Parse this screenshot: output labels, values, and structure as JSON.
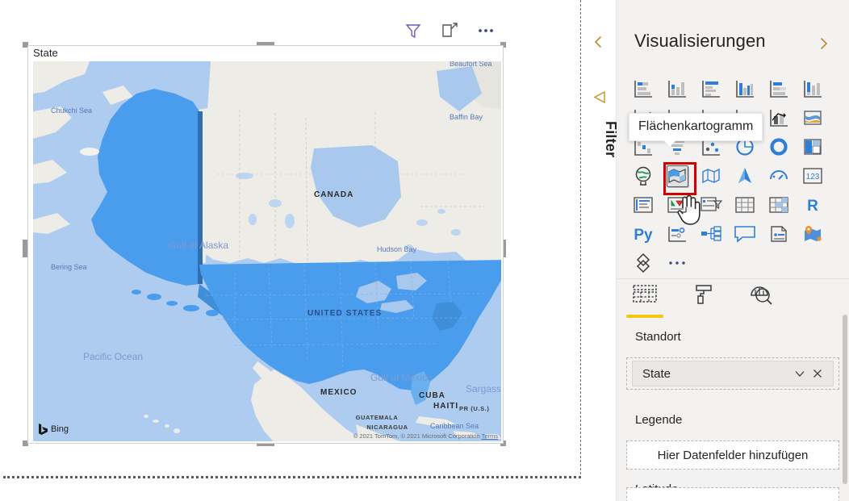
{
  "visual": {
    "title": "State",
    "toolbar": [
      {
        "name": "filter-icon",
        "label": "Filter"
      },
      {
        "name": "focus-mode-icon",
        "label": "Fokusmodus"
      },
      {
        "name": "more-options-icon",
        "label": "Weitere Optionen"
      }
    ],
    "map": {
      "provider": "Bing",
      "attribution": "© 2021 TomTom, © 2021 Microsoft Corporation",
      "terms_label": "Terms",
      "highlight_color": "#4a9ded",
      "water_color": "#aecbf0",
      "land_color": "#eeece7",
      "labels": [
        {
          "text": "Beaufort Sea",
          "type": "sea"
        },
        {
          "text": "Chukchi Sea",
          "type": "sea"
        },
        {
          "text": "Bering Sea",
          "type": "sea"
        },
        {
          "text": "Gulf of Alaska",
          "type": "sea-big"
        },
        {
          "text": "Hudson Bay",
          "type": "sea"
        },
        {
          "text": "Baffin Bay",
          "type": "sea"
        },
        {
          "text": "Pacific Ocean",
          "type": "sea-big"
        },
        {
          "text": "Gulf of Mexico",
          "type": "sea-big"
        },
        {
          "text": "Caribbean Sea",
          "type": "sea"
        },
        {
          "text": "Sargass",
          "type": "sea-big"
        },
        {
          "text": "CANADA",
          "type": "country"
        },
        {
          "text": "UNITED STATES",
          "type": "country-blue"
        },
        {
          "text": "MEXICO",
          "type": "country"
        },
        {
          "text": "CUBA",
          "type": "country"
        },
        {
          "text": "HAITI",
          "type": "country"
        },
        {
          "text": "PR (U.S.)",
          "type": "country-sm"
        },
        {
          "text": "GUATEMALA",
          "type": "country-sm"
        },
        {
          "text": "NICARAGUA",
          "type": "country-sm"
        }
      ]
    }
  },
  "filter_rail": {
    "collapse_label": "Filter-Bereich erweitern",
    "title": "Filter",
    "icons": [
      "chevron-left-icon",
      "filter-icon"
    ]
  },
  "viz_pane": {
    "title": "Visualisierungen",
    "expand_icon": "chevron-right-icon",
    "tooltip": "Flächenkartogramm",
    "icons": [
      {
        "name": "stacked-bar-chart",
        "row": 1
      },
      {
        "name": "stacked-column-chart",
        "row": 1
      },
      {
        "name": "clustered-bar-chart",
        "row": 1
      },
      {
        "name": "clustered-column-chart",
        "row": 1
      },
      {
        "name": "100-stacked-bar-chart",
        "row": 1
      },
      {
        "name": "100-stacked-column-chart",
        "row": 1
      },
      {
        "name": "line-chart",
        "row": 2
      },
      {
        "name": "area-chart",
        "row": 2
      },
      {
        "name": "stacked-area-chart",
        "row": 2
      },
      {
        "name": "line-stacked-column-chart",
        "row": 2
      },
      {
        "name": "line-clustered-column-chart",
        "row": 2
      },
      {
        "name": "ribbon-chart",
        "row": 2
      },
      {
        "name": "waterfall-chart",
        "row": 3
      },
      {
        "name": "funnel-chart",
        "row": 3
      },
      {
        "name": "scatter-chart",
        "row": 3
      },
      {
        "name": "pie-chart",
        "row": 3
      },
      {
        "name": "donut-chart",
        "row": 3
      },
      {
        "name": "treemap-chart",
        "row": 3
      },
      {
        "name": "map-visual",
        "row": 4
      },
      {
        "name": "filled-map-visual",
        "row": 4,
        "selected": true
      },
      {
        "name": "shape-map-visual",
        "row": 4
      },
      {
        "name": "azure-map-visual",
        "row": 4
      },
      {
        "name": "gauge-visual",
        "row": 4
      },
      {
        "name": "card-visual",
        "row": 4
      },
      {
        "name": "multi-row-card-visual",
        "row": 5
      },
      {
        "name": "kpi-visual",
        "row": 5
      },
      {
        "name": "slicer-visual",
        "row": 5
      },
      {
        "name": "table-visual",
        "row": 5
      },
      {
        "name": "matrix-visual",
        "row": 5
      },
      {
        "name": "r-script-visual",
        "row": 5
      },
      {
        "name": "python-visual",
        "row": 6
      },
      {
        "name": "key-influencers-visual",
        "row": 6
      },
      {
        "name": "decomposition-tree-visual",
        "row": 6
      },
      {
        "name": "qna-visual",
        "row": 6
      },
      {
        "name": "smart-narrative-visual",
        "row": 6
      },
      {
        "name": "arcgis-maps-visual",
        "row": 6
      },
      {
        "name": "paginated-report-visual",
        "row": 7
      },
      {
        "name": "more-visuals-ellipsis",
        "row": 7
      }
    ],
    "field_tabs": [
      {
        "name": "fields-tab",
        "icon": "fields-icon",
        "active": true
      },
      {
        "name": "format-tab",
        "icon": "paint-roller-icon",
        "active": false
      },
      {
        "name": "analytics-tab",
        "icon": "analytics-magnifier-icon",
        "active": false
      }
    ],
    "wells": [
      {
        "label": "Standort",
        "field": "State",
        "field_actions": [
          "chevron-down-icon",
          "remove-field-icon"
        ]
      },
      {
        "label": "Legende",
        "placeholder": "Hier Datenfelder hinzufügen"
      },
      {
        "label": "Latitude",
        "placeholder": ""
      }
    ]
  }
}
